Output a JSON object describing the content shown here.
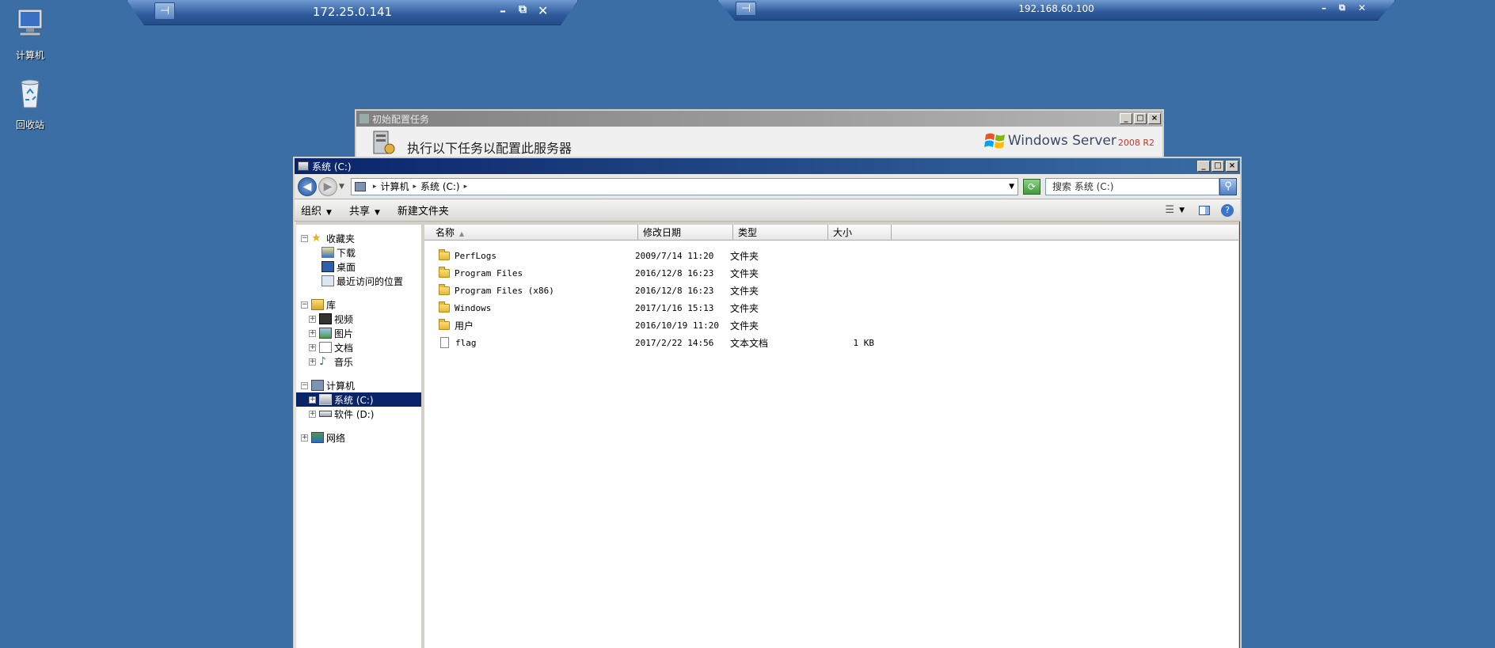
{
  "desktop": {
    "icons": [
      {
        "label": "计算机"
      },
      {
        "label": "回收站"
      }
    ]
  },
  "rdp_bars": [
    {
      "address": "172.25.0.141",
      "pin": "⊣",
      "minimize": "–",
      "restore": "⧉",
      "close": "✕"
    },
    {
      "address": "192.168.60.100",
      "pin": "⊣",
      "minimize": "–",
      "restore": "⧉",
      "close": "✕"
    }
  ],
  "background_window": {
    "title": "初始配置任务",
    "heading": "执行以下任务以配置此服务器",
    "logo_text": "Windows Server",
    "logo_version": "2008 R2"
  },
  "explorer": {
    "title": "系统 (C:)",
    "address": {
      "crumbs": [
        "计算机",
        "系统 (C:)"
      ]
    },
    "search": {
      "placeholder": "搜索 系统 (C:)"
    },
    "toolbar": {
      "organize": "组织",
      "share": "共享",
      "new_folder": "新建文件夹"
    },
    "nav": {
      "favorites": "收藏夹",
      "downloads": "下载",
      "desktop": "桌面",
      "recent": "最近访问的位置",
      "libraries": "库",
      "videos": "视频",
      "pictures": "图片",
      "documents": "文档",
      "music": "音乐",
      "computer": "计算机",
      "drive_c": "系统 (C:)",
      "drive_d": "软件 (D:)",
      "network": "网络"
    },
    "columns": {
      "name": "名称",
      "modified": "修改日期",
      "type": "类型",
      "size": "大小"
    },
    "files": [
      {
        "name": "PerfLogs",
        "modified": "2009/7/14 11:20",
        "type": "文件夹",
        "size": ""
      },
      {
        "name": "Program Files",
        "modified": "2016/12/8 16:23",
        "type": "文件夹",
        "size": ""
      },
      {
        "name": "Program Files (x86)",
        "modified": "2016/12/8 16:23",
        "type": "文件夹",
        "size": ""
      },
      {
        "name": "Windows",
        "modified": "2017/1/16 15:13",
        "type": "文件夹",
        "size": ""
      },
      {
        "name": "用户",
        "modified": "2016/10/19 11:20",
        "type": "文件夹",
        "size": ""
      },
      {
        "name": "flag",
        "modified": "2017/2/22 14:56",
        "type": "文本文档",
        "size": "1 KB"
      }
    ]
  }
}
